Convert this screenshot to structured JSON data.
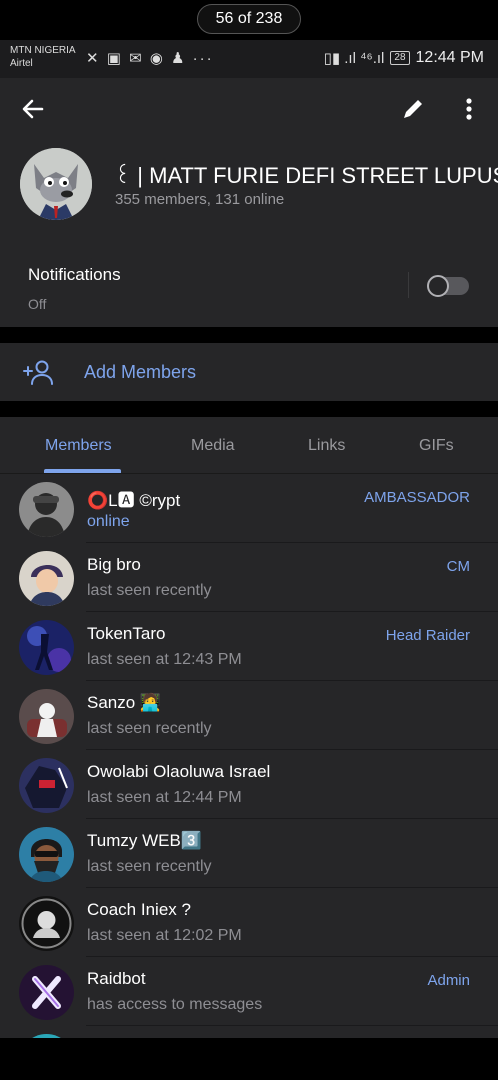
{
  "viewer": {
    "counter": "56 of 238"
  },
  "status_bar": {
    "carrier_line1": "MTN NIGERIA",
    "carrier_line2": "Airtel",
    "left_icons": "✕ ▣ ✉ ◉ ♟ ···",
    "signal": "▯▮ .ıl ⁴⁶.ıl",
    "battery": "28",
    "time": "12:44 PM"
  },
  "group": {
    "name": "꒰ | MATT FURIE DEFI STREET   LUPUS",
    "subtitle": "355 members, 131 online"
  },
  "notifications": {
    "title": "Notifications",
    "value": "Off",
    "enabled": false
  },
  "add_members": {
    "label": "Add Members"
  },
  "tabs": [
    {
      "label": "Members",
      "active": true
    },
    {
      "label": "Media",
      "active": false
    },
    {
      "label": "Links",
      "active": false
    },
    {
      "label": "GIFs",
      "active": false
    }
  ],
  "members": [
    {
      "name": "⭕L🅰 ©rypt",
      "status": "online",
      "role": "AMBASSADOR",
      "online": true,
      "avatar_color": "#8c8c8c"
    },
    {
      "name": "Big bro",
      "status": "last seen recently",
      "role": "CM",
      "online": false,
      "avatar_color": "#c9c4bb"
    },
    {
      "name": "TokenTaro",
      "status": "last seen at 12:43 PM",
      "role": "Head Raider",
      "online": false,
      "avatar_color": "#2a3d8f"
    },
    {
      "name": "Sanzo 🧑‍💻",
      "status": "last seen recently",
      "role": "",
      "online": false,
      "avatar_color": "#6a5a5a"
    },
    {
      "name": "Owolabi Olaoluwa Israel",
      "status": "last seen at 12:44 PM",
      "role": "",
      "online": false,
      "avatar_color": "#3a3f6e"
    },
    {
      "name": "Tumzy WEB3️⃣",
      "status": "last seen recently",
      "role": "",
      "online": false,
      "avatar_color": "#2d7fa6"
    },
    {
      "name": "Coach Iniex ?",
      "status": "last seen at 12:02 PM",
      "role": "",
      "online": false,
      "avatar_color": "#1e1e1e"
    },
    {
      "name": "Raidbot",
      "status": "has access to messages",
      "role": "Admin",
      "online": false,
      "avatar_color": "#2b1540"
    }
  ],
  "colors": {
    "accent": "#7ea4ec",
    "surface": "#262628",
    "muted": "#8e8e93"
  }
}
